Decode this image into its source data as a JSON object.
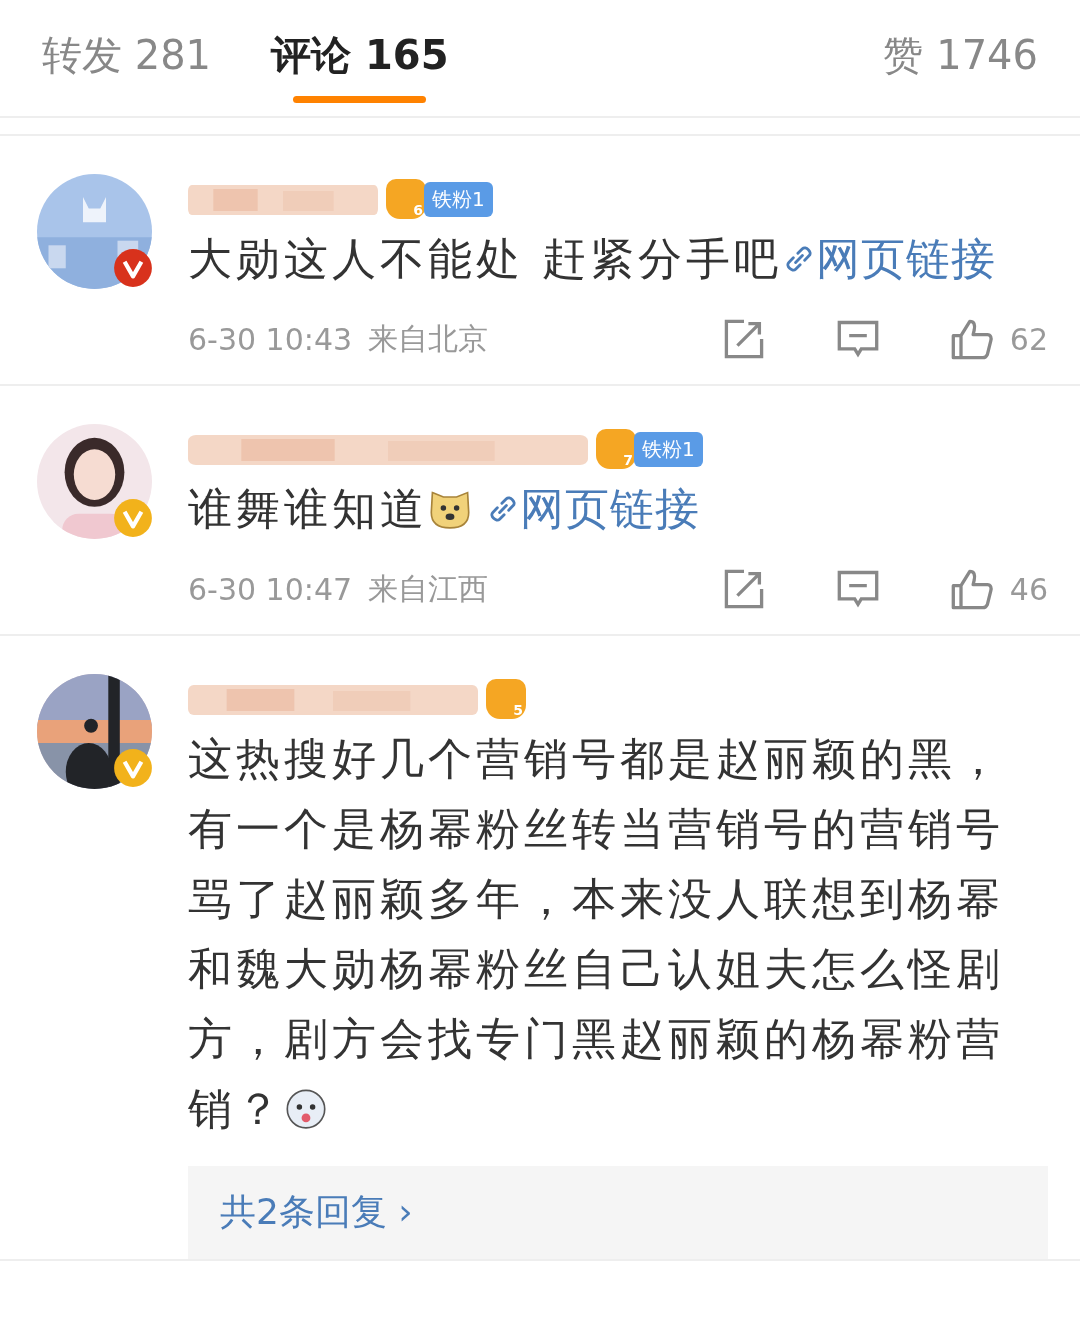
{
  "tabs": [
    {
      "label": "转发",
      "count": "281",
      "selected": false
    },
    {
      "label": "评论",
      "count": "165",
      "selected": true
    }
  ],
  "like_tab": {
    "label": "赞",
    "count": "1746"
  },
  "comments": [
    {
      "avatar": {
        "kind": "picture"
      },
      "verified_badge": {
        "color": "#d8321c"
      },
      "crown_level": "6",
      "fan_badge": "铁粉1",
      "segments": [
        {
          "kind": "text",
          "text": "大勋这人不能处 赶紧分手吧"
        },
        {
          "kind": "link",
          "text": "网页链接"
        }
      ],
      "time": "6-30 10:43",
      "location": "来自北京",
      "likes": "62"
    },
    {
      "avatar": {
        "kind": "picture"
      },
      "verified_badge": {
        "color": "#f2b21b"
      },
      "crown_level": "7",
      "fan_badge": "铁粉1",
      "segments": [
        {
          "kind": "text",
          "text": "谁舞谁知道"
        },
        {
          "kind": "dog_emoji"
        },
        {
          "kind": "link",
          "text": "网页链接"
        }
      ],
      "time": "6-30 10:47",
      "location": "来自江西",
      "likes": "46"
    },
    {
      "avatar": {
        "kind": "picture"
      },
      "verified_badge": {
        "color": "#f2b21b"
      },
      "crown_level": "5",
      "segments": [
        {
          "kind": "text",
          "text": "这热搜好几个营销号都是赵丽颖的黑，有一个是杨幂粉丝转当营销号的营销号骂了赵丽颖多年，本来没人联想到杨幂和魏大勋杨幂粉丝自己认姐夫怎么怪剧方，剧方会找专门黑赵丽颖的杨幂粉营销？"
        },
        {
          "kind": "husky_emoji"
        }
      ],
      "replies": "共2条回复 ›"
    }
  ]
}
